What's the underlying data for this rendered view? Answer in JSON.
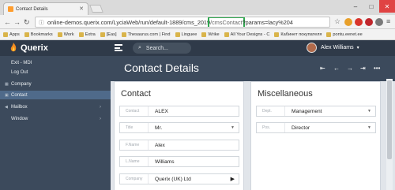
{
  "browser": {
    "tab_title": "Contact Details",
    "url_prefix": "online-demos.querix.com/LyciaWeb/run/default-1889/cms_2019",
    "url_highlight": "/cmsContact",
    "url_suffix": "?params=lacy%204",
    "bookmarks": [
      "Apps",
      "Bookmarks",
      "Work",
      "Extra",
      "[Eas]",
      "Thesaurus.com | Find",
      "Linguee",
      "Wrike",
      "All Your Designs - C",
      "Кабинет покупателя",
      "pontu.eenet.ee"
    ]
  },
  "app": {
    "logo_text": "Querix",
    "search_placeholder": "Search...",
    "user_name": "Alex Williams"
  },
  "sidebar": {
    "items": [
      {
        "label": "Exit - MDI"
      },
      {
        "label": "Log Out"
      },
      {
        "label": "Company"
      },
      {
        "label": "Contact"
      },
      {
        "label": "Mailbox"
      },
      {
        "label": "Window"
      }
    ]
  },
  "page": {
    "title": "Contact Details"
  },
  "contact": {
    "card_title": "Contact",
    "fields": [
      {
        "label": "Contact",
        "value": "ALEX"
      },
      {
        "label": "Title",
        "value": "Mr."
      },
      {
        "label": "F.Name",
        "value": "Alex"
      },
      {
        "label": "L.Name",
        "value": "Williams"
      },
      {
        "label": "Company",
        "value": "Querix (UK) Ltd"
      }
    ]
  },
  "misc": {
    "card_title": "Miscellaneous",
    "fields": [
      {
        "label": "Dept.",
        "value": "Management"
      },
      {
        "label": "Pos.",
        "value": "Director"
      }
    ]
  }
}
